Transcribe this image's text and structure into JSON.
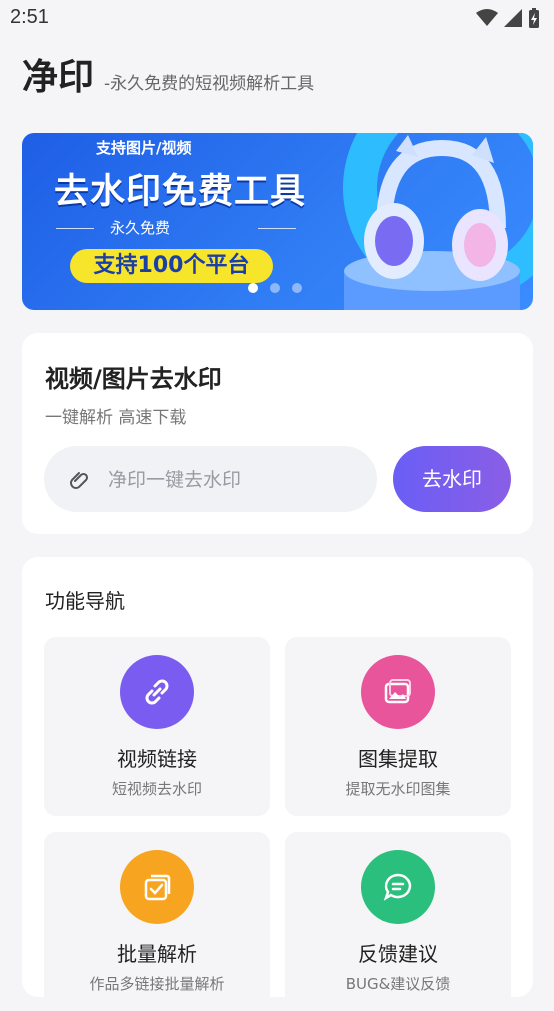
{
  "status_bar": {
    "time": "2:51"
  },
  "header": {
    "title": "净印",
    "subtitle": "-永久免费的短视频解析工具"
  },
  "banner": {
    "top_text": "支持图片/视频",
    "main_text": "去水印免费工具",
    "free_text": "永久免费",
    "pill_text": "支持100个平台",
    "active_slide": 0,
    "slide_count": 3
  },
  "remove_card": {
    "title": "视频/图片去水印",
    "subtitle": "一键解析 高速下载",
    "input_placeholder": "净印一键去水印",
    "button_label": "去水印"
  },
  "nav": {
    "title": "功能导航",
    "items": [
      {
        "title": "视频链接",
        "desc": "短视频去水印",
        "icon": "link-icon",
        "color": "#7b5cf0"
      },
      {
        "title": "图集提取",
        "desc": "提取无水印图集",
        "icon": "gallery-icon",
        "color": "#e8559a"
      },
      {
        "title": "批量解析",
        "desc": "作品多链接批量解析",
        "icon": "batch-check-icon",
        "color": "#f7a520"
      },
      {
        "title": "反馈建议",
        "desc": "BUG&建议反馈",
        "icon": "feedback-chat-icon",
        "color": "#2bbf7e"
      }
    ]
  }
}
